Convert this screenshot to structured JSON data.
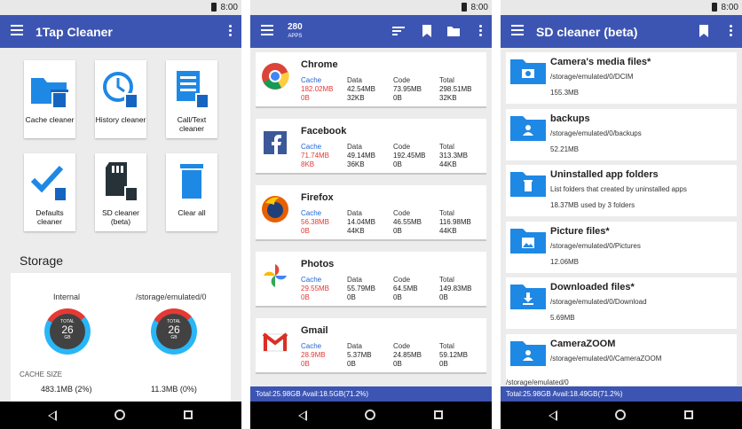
{
  "status": {
    "time": "8:00"
  },
  "screen1": {
    "title": "1Tap Cleaner",
    "tiles": [
      {
        "label": "Cache cleaner",
        "icon": "folder-trash-icon"
      },
      {
        "label": "History cleaner",
        "icon": "history-trash-icon"
      },
      {
        "label": "Call/Text cleaner",
        "icon": "list-trash-icon"
      },
      {
        "label": "Defaults cleaner",
        "icon": "check-trash-icon"
      },
      {
        "label": "SD cleaner (beta)",
        "icon": "sdcard-trash-icon"
      },
      {
        "label": "Clear all",
        "icon": "trash-icon"
      }
    ],
    "storage_title": "Storage",
    "internal_label": "Internal",
    "external_label": "/storage/emulated/0",
    "donut_total": "TOTAL",
    "donut_value": "26",
    "donut_unit": "GB",
    "cache_size_title": "CACHE SIZE",
    "cache_internal": "483.1MB (2%)",
    "cache_external": "11.3MB (0%)"
  },
  "screen2": {
    "count": "280",
    "count_label": "APPS",
    "col_headers": {
      "cache": "Cache",
      "data": "Data",
      "code": "Code",
      "total": "Total"
    },
    "apps": [
      {
        "name": "Chrome",
        "cache": "182.02MB",
        "cache2": "0B",
        "data": "42.54MB",
        "data2": "32KB",
        "code": "73.95MB",
        "code2": "0B",
        "total": "298.51MB",
        "total2": "32KB"
      },
      {
        "name": "Facebook",
        "cache": "71.74MB",
        "cache2": "8KB",
        "data": "49.14MB",
        "data2": "36KB",
        "code": "192.45MB",
        "code2": "0B",
        "total": "313.3MB",
        "total2": "44KB"
      },
      {
        "name": "Firefox",
        "cache": "56.38MB",
        "cache2": "0B",
        "data": "14.04MB",
        "data2": "44KB",
        "code": "46.55MB",
        "code2": "0B",
        "total": "116.98MB",
        "total2": "44KB"
      },
      {
        "name": "Photos",
        "cache": "29.55MB",
        "cache2": "0B",
        "data": "55.79MB",
        "data2": "0B",
        "code": "64.5MB",
        "code2": "0B",
        "total": "149.83MB",
        "total2": "0B"
      },
      {
        "name": "Gmail",
        "cache": "28.9MB",
        "cache2": "0B",
        "data": "5.37MB",
        "data2": "0B",
        "code": "24.85MB",
        "code2": "0B",
        "total": "59.12MB",
        "total2": "0B"
      }
    ],
    "footer": "Total:25.98GB    Avail:18.5GB(71.2%)"
  },
  "screen3": {
    "title": "SD cleaner (beta)",
    "folders": [
      {
        "name": "Camera's media files*",
        "path": "/storage/emulated/0/DCIM",
        "size": "155.3MB",
        "icon": "camera-folder-icon"
      },
      {
        "name": "backups",
        "path": "/storage/emulated/0/backups",
        "size": "52.21MB",
        "icon": "person-folder-icon"
      },
      {
        "name": "Uninstalled app folders",
        "path": "List folders that created by uninstalled apps",
        "size": "18.37MB used by 3 folders",
        "icon": "trash-folder-icon"
      },
      {
        "name": "Picture  files*",
        "path": "/storage/emulated/0/Pictures",
        "size": "12.06MB",
        "icon": "image-folder-icon"
      },
      {
        "name": "Downloaded files*",
        "path": "/storage/emulated/0/Download",
        "size": "5.69MB",
        "icon": "download-folder-icon"
      },
      {
        "name": "CameraZOOM",
        "path": "/storage/emulated/0/CameraZOOM",
        "size": "",
        "icon": "person-folder-icon"
      }
    ],
    "path_bar": "/storage/emulated/0",
    "footer": "Total:25.98GB    Avail:18.49GB(71.2%)"
  }
}
